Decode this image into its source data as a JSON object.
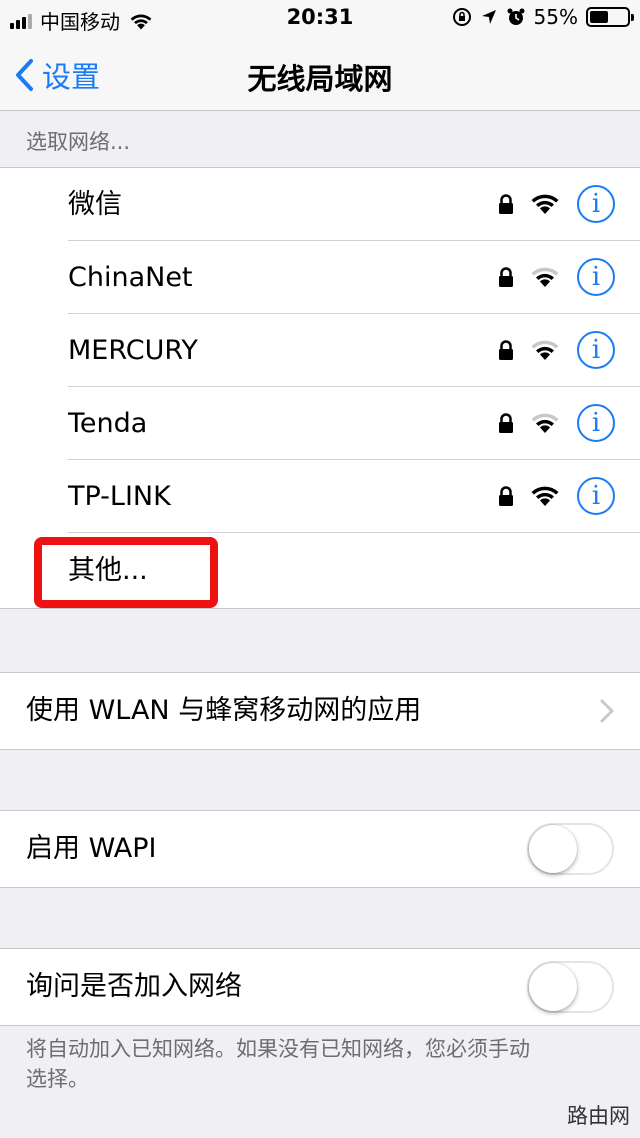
{
  "status_bar": {
    "carrier": "中国移动",
    "time": "20:31",
    "battery_percent": "55%",
    "battery_level": 0.55
  },
  "nav": {
    "back_label": "设置",
    "title": "无线局域网"
  },
  "networks_section": {
    "header": "选取网络...",
    "networks": [
      {
        "name": "微信",
        "secured": true,
        "signal": "full"
      },
      {
        "name": "ChinaNet",
        "secured": true,
        "signal": "medium"
      },
      {
        "name": "MERCURY",
        "secured": true,
        "signal": "medium"
      },
      {
        "name": "Tenda",
        "secured": true,
        "signal": "medium"
      },
      {
        "name": "TP-LINK",
        "secured": true,
        "signal": "full"
      }
    ],
    "other_label": "其他..."
  },
  "apps_cell": {
    "label": "使用 WLAN 与蜂窝移动网的应用"
  },
  "wapi_cell": {
    "label": "启用 WAPI",
    "enabled": false
  },
  "ask_join_cell": {
    "label": "询问是否加入网络",
    "enabled": false
  },
  "footer": {
    "note": "将自动加入已知网络。如果没有已知网络，您必须手动选择。"
  },
  "watermark": "路由网",
  "colors": {
    "accent": "#1a7cf5",
    "background": "#efeff4",
    "annotation": "#ee1111"
  }
}
